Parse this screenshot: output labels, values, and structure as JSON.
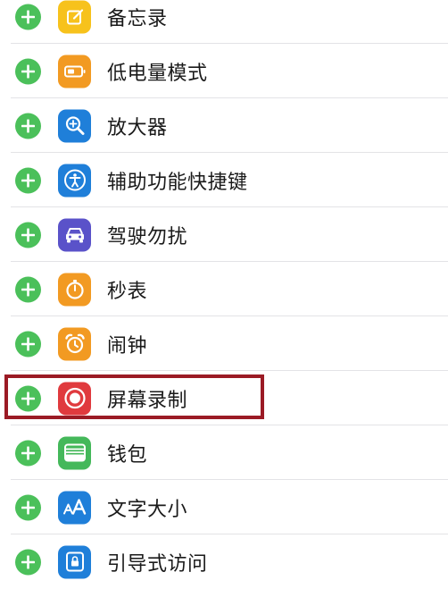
{
  "items": [
    {
      "label": "备忘录",
      "icon": "notes-icon",
      "color": "#f7c21c"
    },
    {
      "label": "低电量模式",
      "icon": "battery-icon",
      "color": "#f29a22"
    },
    {
      "label": "放大器",
      "icon": "magnifier-icon",
      "color": "#1f7fd9"
    },
    {
      "label": "辅助功能快捷键",
      "icon": "accessibility-icon",
      "color": "#1f7fd9"
    },
    {
      "label": "驾驶勿扰",
      "icon": "car-icon",
      "color": "#5a52c9"
    },
    {
      "label": "秒表",
      "icon": "stopwatch-icon",
      "color": "#f29a22"
    },
    {
      "label": "闹钟",
      "icon": "alarm-clock-icon",
      "color": "#f29a22"
    },
    {
      "label": "屏幕录制",
      "icon": "screen-record-icon",
      "color": "#e03a3e"
    },
    {
      "label": "钱包",
      "icon": "wallet-icon",
      "color": "#44b85a"
    },
    {
      "label": "文字大小",
      "icon": "text-size-icon",
      "color": "#1f7fd9"
    },
    {
      "label": "引导式访问",
      "icon": "guided-access-icon",
      "color": "#1f7fd9"
    }
  ],
  "add_button_color": "#4bc05a",
  "highlight_color": "#9b1b25"
}
